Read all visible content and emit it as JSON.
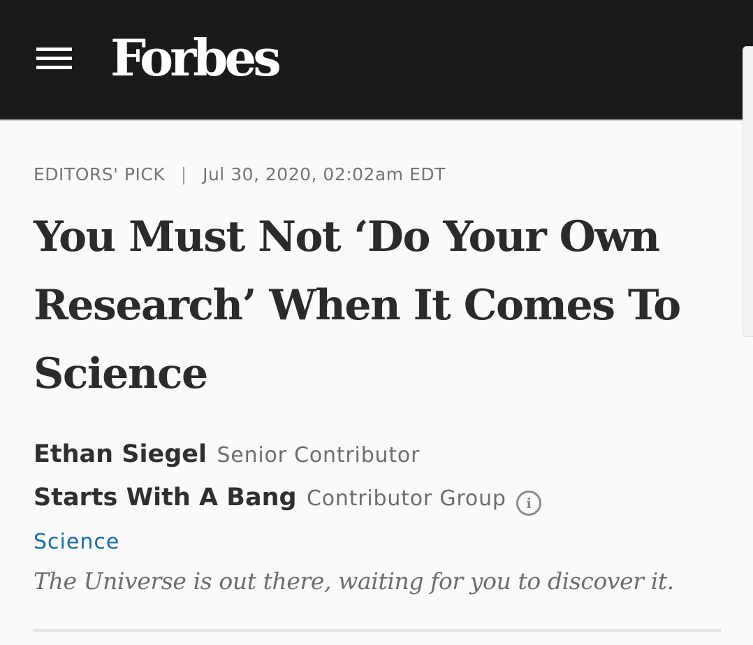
{
  "header": {
    "logo": "Forbes",
    "menu_icon": "hamburger-menu-icon",
    "background": "#1b1a19"
  },
  "article": {
    "label": "EDITORS' PICK",
    "separator": "|",
    "date": "Jul 30, 2020, 02:02am EDT",
    "headline": "You Must Not ‘Do Your Own Research’ When It Comes To Science",
    "author": {
      "name": "Ethan Siegel",
      "role": "Senior Contributor"
    },
    "group": {
      "name": "Starts With A Bang",
      "type": "Contributor Group",
      "info_icon": "info-icon"
    },
    "section": "Science",
    "tagline": "The Universe is out there, waiting for you to discover it."
  },
  "colors": {
    "section_link": "#1b6ea5",
    "headline": "#2b2b2b",
    "meta_text": "#757575"
  }
}
